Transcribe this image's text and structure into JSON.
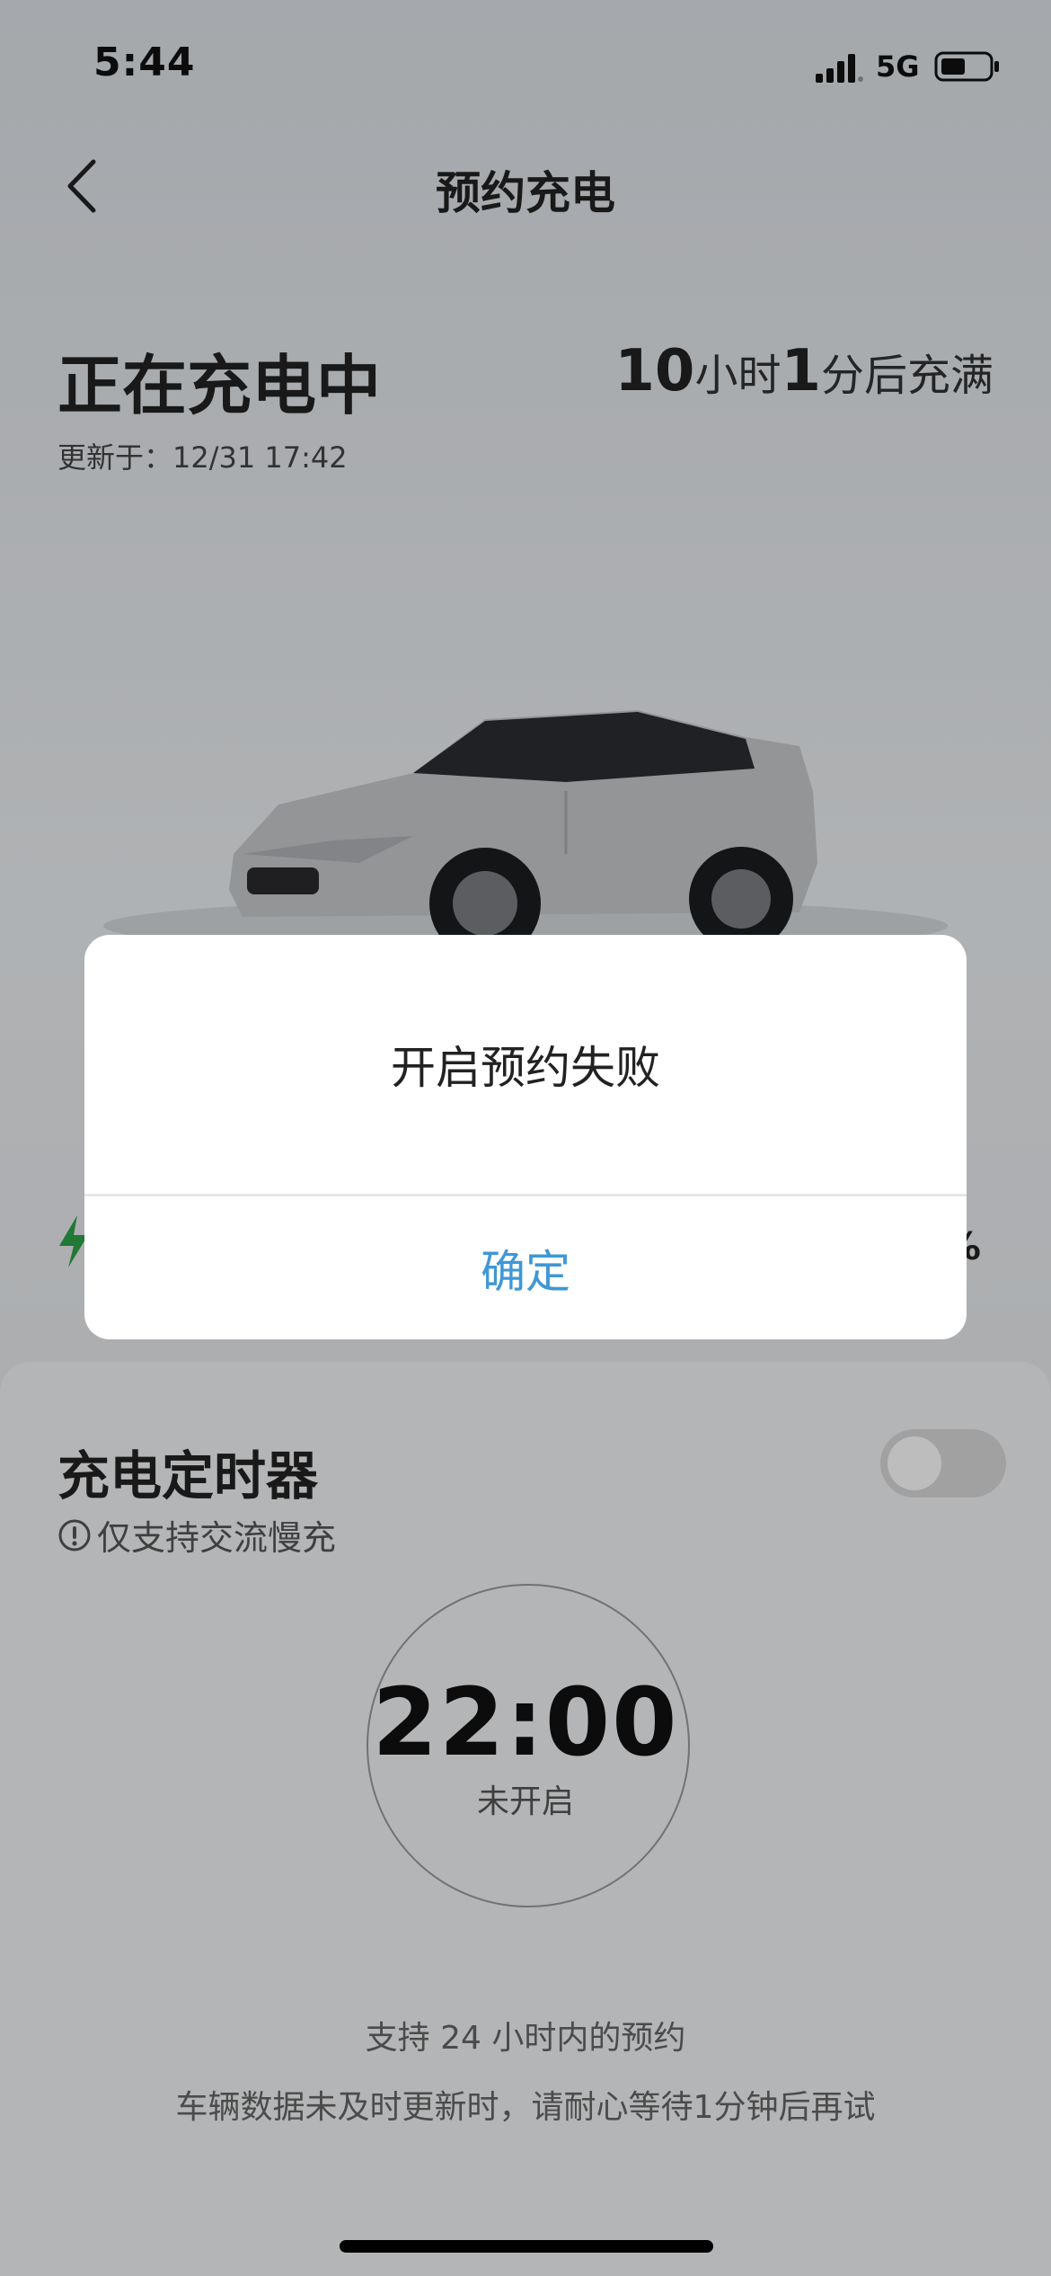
{
  "status_bar": {
    "time": "5:44",
    "network": "5G"
  },
  "header": {
    "title": "预约充电"
  },
  "charging": {
    "status": "正在充电中",
    "updated": "更新于：12/31 17:42",
    "eta_hours": "10",
    "eta_hours_unit": "小时",
    "eta_minutes": "1",
    "eta_suffix": "分后充满",
    "percent_visible": "%"
  },
  "timer": {
    "title": "充电定时器",
    "note": "仅支持交流慢充",
    "toggle_on": false,
    "time": "22:00",
    "state": "未开启",
    "tip1": "支持 24 小时内的预约",
    "tip2": "车辆数据未及时更新时，请耐心等待1分钟后再试"
  },
  "dialog": {
    "message": "开启预约失败",
    "confirm_label": "确定"
  },
  "colors": {
    "accent": "#3f97d6",
    "charge_green": "#2fa24a"
  },
  "icons": [
    "back-chevron-icon",
    "signal-icon",
    "battery-icon",
    "lightning-icon",
    "info-icon"
  ]
}
